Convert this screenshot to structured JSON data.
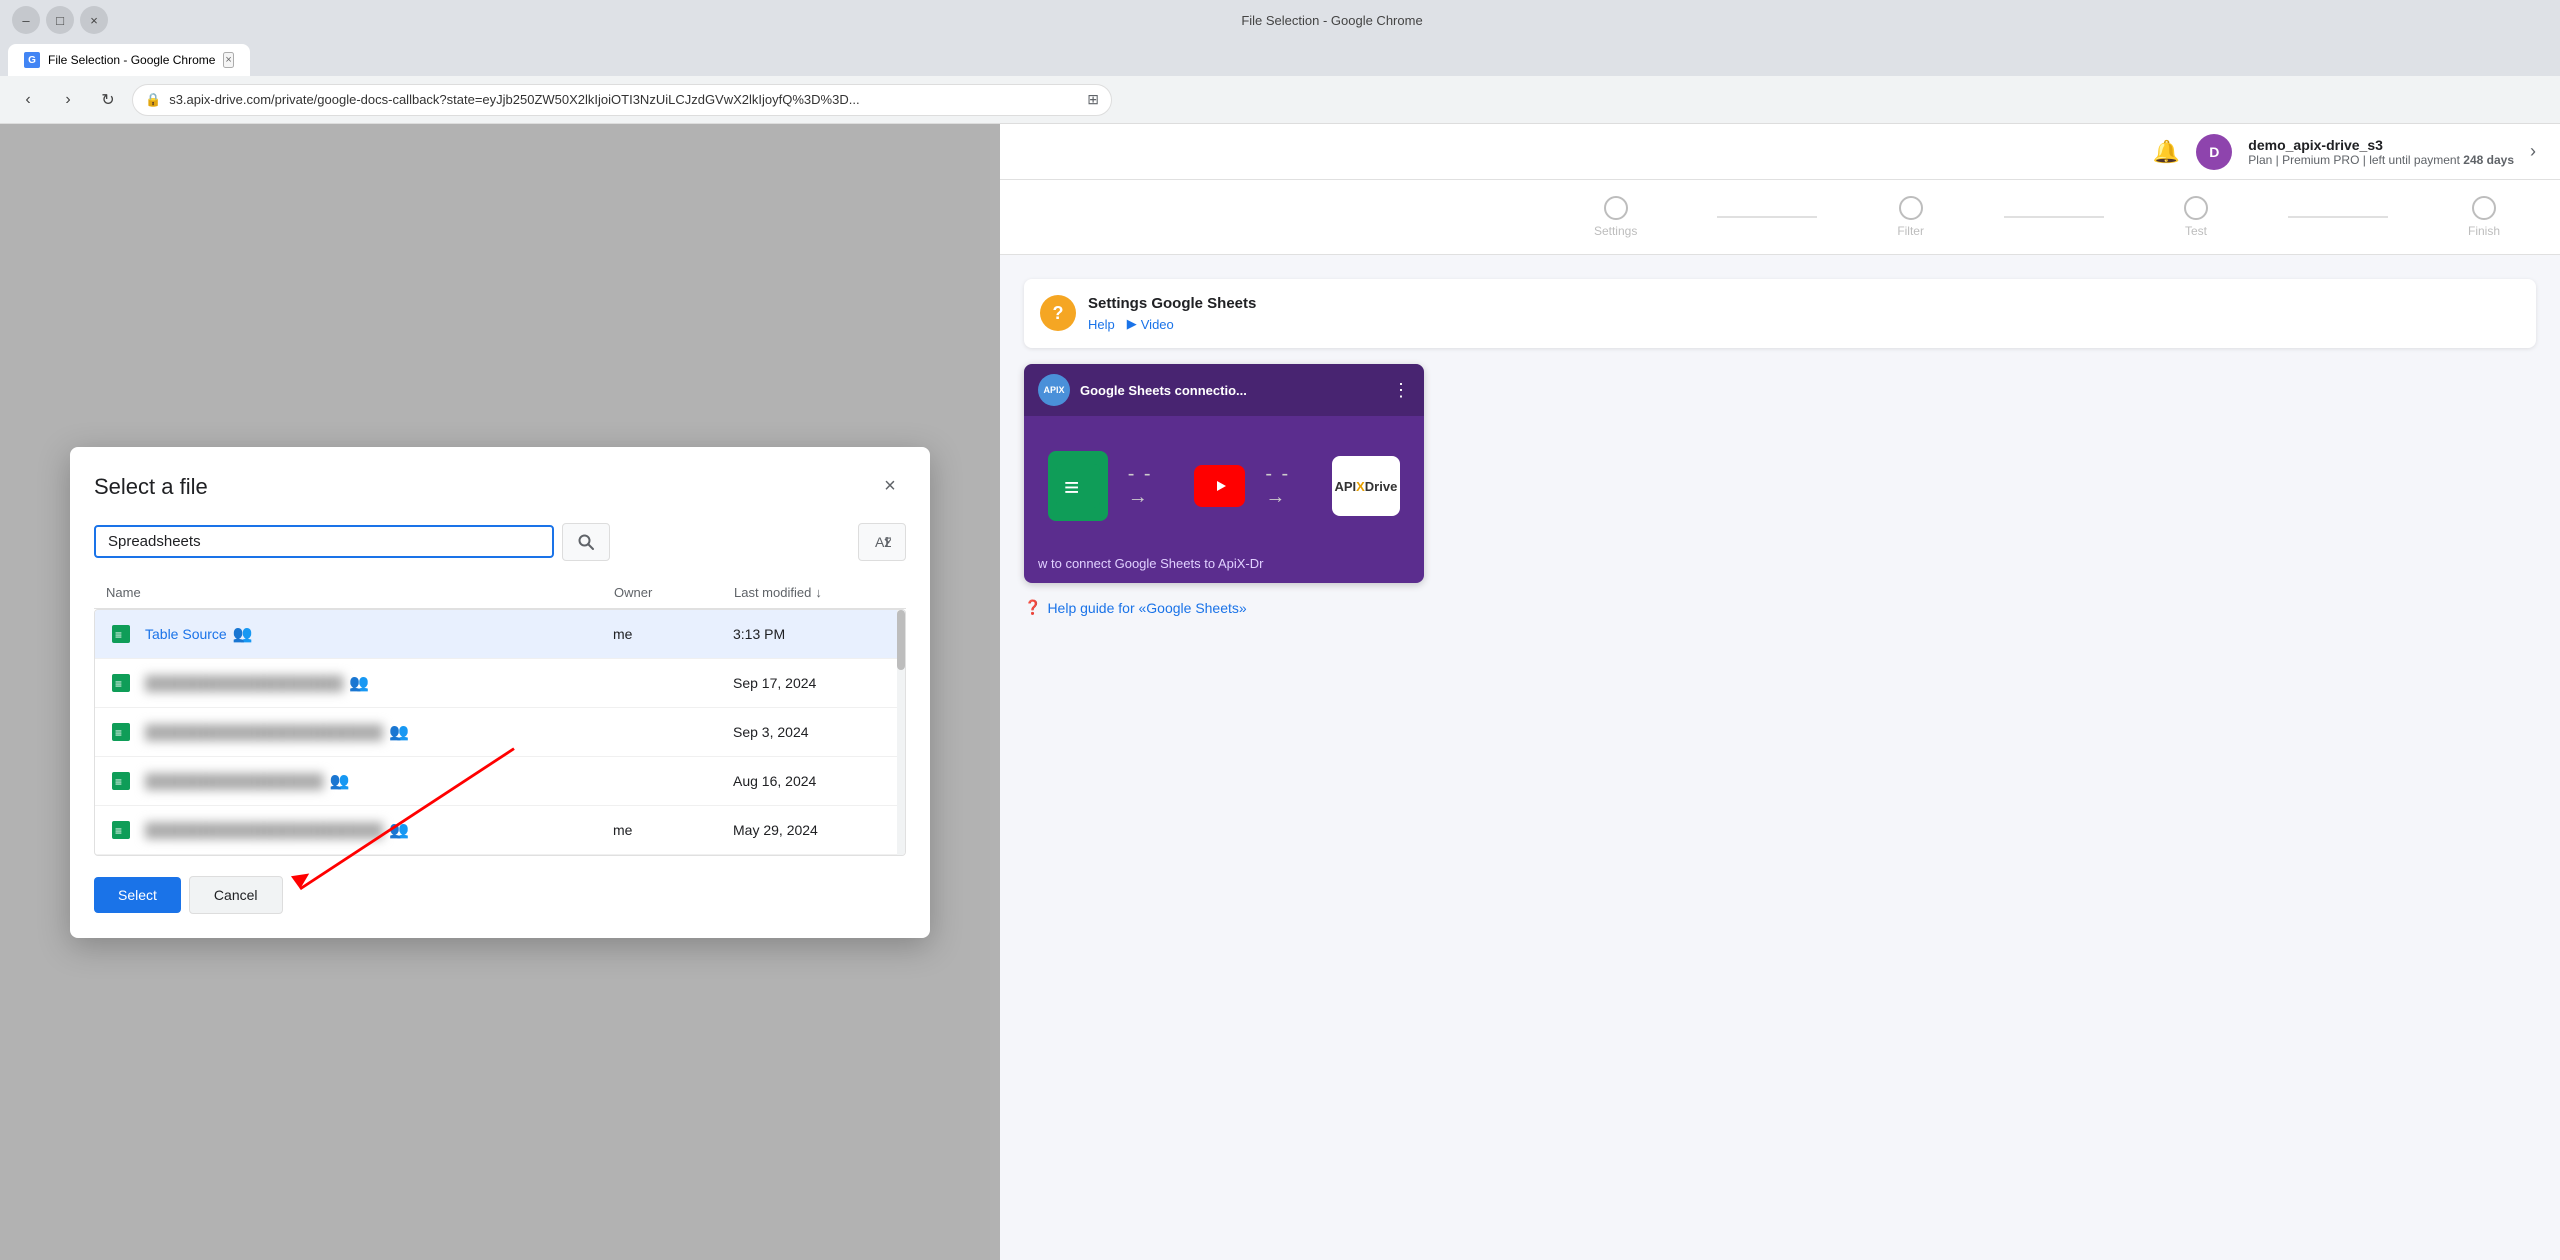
{
  "browser": {
    "title": "File Selection - Google Chrome",
    "tab_label": "File Selection - Google Chrome",
    "address": "s3.apix-drive.com/private/google-docs-callback?state=eyJjb250ZW50X2lkIjoiOTI3NzUiLCJzdGVwX2lkIjoyfQ%3D%3D...",
    "min_label": "–",
    "max_label": "□",
    "close_label": "×"
  },
  "dialog": {
    "title": "Select a file",
    "close_label": "×",
    "search_value": "Spreadsheets",
    "search_placeholder": "Search",
    "table": {
      "col_name": "Name",
      "col_owner": "Owner",
      "col_modified": "Last modified"
    },
    "files": [
      {
        "name": "Table Source",
        "icon": "📗",
        "owner": "me",
        "modified": "3:13 PM",
        "selected": true,
        "blurred": false,
        "shared": true
      },
      {
        "name": "blurred file 1",
        "icon": "📗",
        "owner": "",
        "modified": "Sep 17, 2024",
        "selected": false,
        "blurred": true,
        "shared": true
      },
      {
        "name": "blurred file 2",
        "icon": "📗",
        "owner": "",
        "modified": "Sep 3, 2024",
        "selected": false,
        "blurred": true,
        "shared": true
      },
      {
        "name": "blurred file 3",
        "icon": "📗",
        "owner": "",
        "modified": "Aug 16, 2024",
        "selected": false,
        "blurred": true,
        "shared": true
      },
      {
        "name": "blurred file 4",
        "icon": "📗",
        "owner": "me",
        "modified": "May 29, 2024",
        "selected": false,
        "blurred": true,
        "shared": true
      }
    ],
    "btn_select": "Select",
    "btn_cancel": "Cancel"
  },
  "apix": {
    "user_name": "demo_apix-drive_s3",
    "plan": "Plan | Premium PRO | left until payment",
    "plan_days": "248 days",
    "steps": [
      {
        "label": "Settings",
        "active": false
      },
      {
        "label": "Filter",
        "active": false
      },
      {
        "label": "Test",
        "active": false
      },
      {
        "label": "Finish",
        "active": false
      }
    ],
    "help_card": {
      "title": "Settings Google Sheets",
      "link_help": "Help",
      "link_video": "Video"
    },
    "video": {
      "channel": "APIX-Drive",
      "title": "Google Sheets connectio...",
      "caption": "w to connect Google Sheets to ApiX-Dr"
    },
    "help_guide": "Help guide for «Google Sheets»"
  }
}
